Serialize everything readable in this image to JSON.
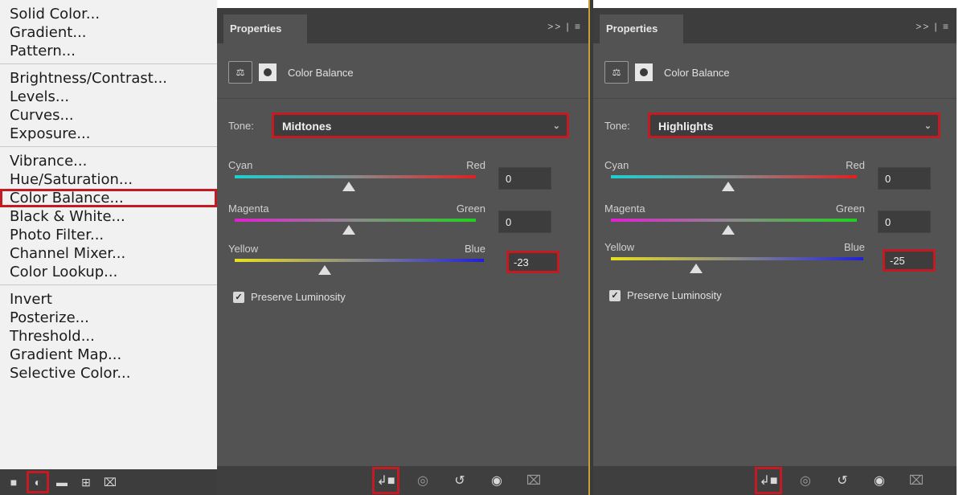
{
  "menu": {
    "groups": [
      [
        "Solid Color...",
        "Gradient...",
        "Pattern..."
      ],
      [
        "Brightness/Contrast...",
        "Levels...",
        "Curves...",
        "Exposure..."
      ],
      [
        "Vibrance...",
        "Hue/Saturation...",
        "Color Balance...",
        "Black & White...",
        "Photo Filter...",
        "Channel Mixer...",
        "Color Lookup..."
      ],
      [
        "Invert",
        "Posterize...",
        "Threshold...",
        "Gradient Map...",
        "Selective Color..."
      ]
    ],
    "selected_item": "Color Balance...",
    "footer_icons": [
      "layer-mask-icon",
      "adjustment-layer-icon",
      "folder-icon",
      "new-layer-icon",
      "trash-icon"
    ]
  },
  "panels": [
    {
      "tab_title": "Properties",
      "tab_controls": ">> | ≡",
      "header_title": "Color Balance",
      "tone_label": "Tone:",
      "tone_value": "Midtones",
      "sliders": [
        {
          "left": "Cyan",
          "right": "Red",
          "value": "0"
        },
        {
          "left": "Magenta",
          "right": "Green",
          "value": "0"
        },
        {
          "left": "Yellow",
          "right": "Blue",
          "value": "-23"
        }
      ],
      "preserve_label": "Preserve Luminosity",
      "preserve_checked": true
    },
    {
      "tab_title": "Properties",
      "tab_controls": ">> | ≡",
      "header_title": "Color Balance",
      "tone_label": "Tone:",
      "tone_value": "Highlights",
      "sliders": [
        {
          "left": "Cyan",
          "right": "Red",
          "value": "0"
        },
        {
          "left": "Magenta",
          "right": "Green",
          "value": "0"
        },
        {
          "left": "Yellow",
          "right": "Blue",
          "value": "-25"
        }
      ],
      "preserve_label": "Preserve Luminosity",
      "preserve_checked": true
    }
  ],
  "colors": {
    "highlight": "#c41a22",
    "panel_bg": "#535353",
    "cyan_red": [
      "#1ecfcf",
      "#e02020"
    ],
    "magenta_green": [
      "#e020d0",
      "#20d020"
    ],
    "yellow_blue": [
      "#e8e020",
      "#2020d8"
    ]
  }
}
